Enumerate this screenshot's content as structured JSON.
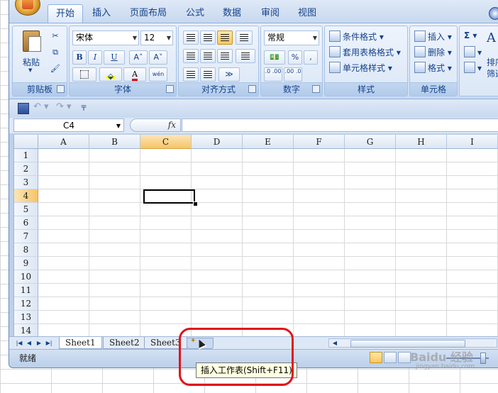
{
  "app": {
    "tabs": [
      "开始",
      "插入",
      "页面布局",
      "公式",
      "数据",
      "审阅",
      "视图"
    ],
    "active_tab": "开始"
  },
  "ribbon": {
    "clipboard": {
      "label": "剪贴板",
      "paste": "粘贴"
    },
    "font": {
      "label": "字体",
      "font_name": "宋体",
      "font_size": "12",
      "bold": "B",
      "italic": "I",
      "underline": "U",
      "grow": "A˄",
      "shrink": "A˅",
      "wen": "wén"
    },
    "alignment": {
      "label": "对齐方式"
    },
    "number": {
      "label": "数字",
      "format": "常规",
      "percent": "%",
      "comma": ",",
      "inc_decimal": ".0 .00",
      "dec_decimal": ".00 .0"
    },
    "styles": {
      "label": "样式",
      "conditional": "条件格式",
      "table": "套用表格格式",
      "cell": "单元格样式"
    },
    "cells": {
      "label": "单元格",
      "insert": "插入",
      "delete": "删除",
      "format": "格式"
    },
    "editing": {
      "sigma": "Σ",
      "sort": "排序",
      "filter": "筛选"
    }
  },
  "formula_bar": {
    "name_box": "C4",
    "fx": "fx",
    "content": ""
  },
  "columns": [
    "A",
    "B",
    "C",
    "D",
    "E",
    "F",
    "G",
    "H",
    "I"
  ],
  "active_column": "C",
  "rows": [
    "1",
    "2",
    "3",
    "4",
    "5",
    "6",
    "7",
    "8",
    "9",
    "10",
    "11",
    "12",
    "13",
    "14"
  ],
  "active_row": "4",
  "sheets": [
    "Sheet1",
    "Sheet2",
    "Sheet3"
  ],
  "active_sheet": "Sheet1",
  "status": {
    "ready": "就绪"
  },
  "tooltip": "插入工作表(Shift+F11)",
  "watermark": {
    "main": "Baidu 经验",
    "sub": "jingyan.baidu.com"
  }
}
